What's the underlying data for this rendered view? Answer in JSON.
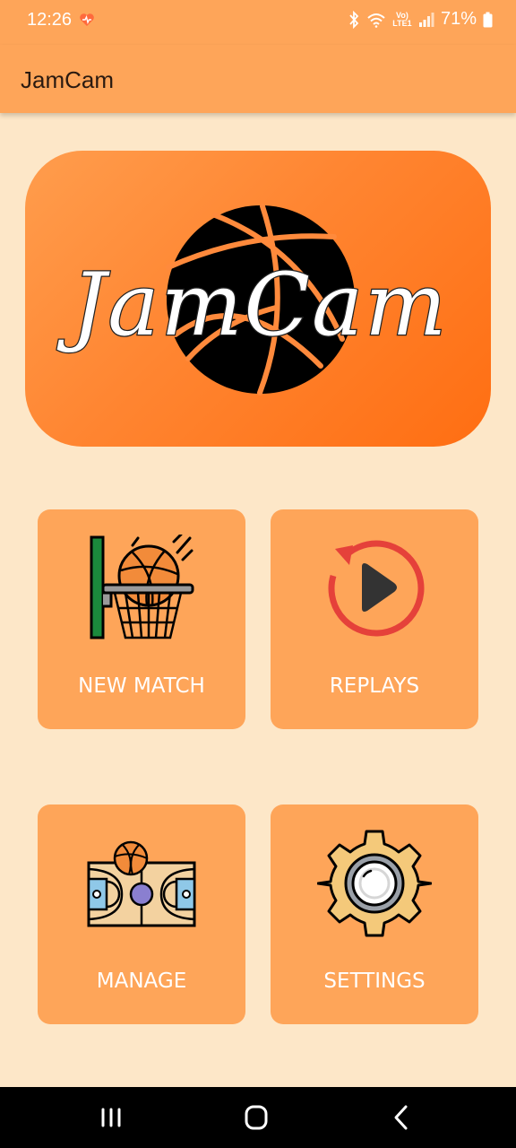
{
  "status_bar": {
    "time": "12:26",
    "network_label": "Vo) LTE1",
    "battery": "71%",
    "icons": [
      "heart-icon",
      "bluetooth-icon",
      "wifi-icon",
      "signal-icon",
      "battery-icon"
    ]
  },
  "app_bar": {
    "title": "JamCam"
  },
  "logo": {
    "text": "JamCam",
    "icon": "basketball-icon"
  },
  "tiles": [
    {
      "label": "NEW MATCH",
      "icon": "basketball-hoop-icon"
    },
    {
      "label": "REPLAYS",
      "icon": "replay-play-icon"
    },
    {
      "label": "MANAGE",
      "icon": "basketball-court-icon"
    },
    {
      "label": "SETTINGS",
      "icon": "gear-icon"
    }
  ],
  "nav_bar": {
    "buttons": [
      "recents",
      "home",
      "back"
    ]
  },
  "colors": {
    "background": "#fde7c8",
    "app_bar": "#fea559",
    "tile": "#fea559",
    "banner": "#ff7a22",
    "ball": "#000000",
    "ball_lines": "#ff8a3c",
    "replay_red": "#e5413a"
  }
}
